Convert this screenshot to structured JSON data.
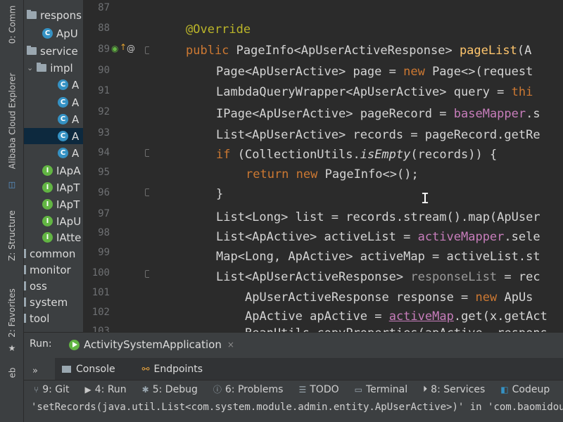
{
  "left_strip": {
    "tabs": [
      {
        "label": "0: Comm",
        "icon": "commit-icon"
      },
      {
        "label": "Alibaba Cloud Explorer",
        "icon": "cloud-explorer-icon"
      },
      {
        "label": "Z: Structure",
        "icon": "structure-icon"
      },
      {
        "label": "2: Favorites",
        "icon": "star-icon"
      },
      {
        "label": "eb"
      }
    ]
  },
  "project_tree": {
    "items": [
      {
        "label": "respons",
        "type": "folder",
        "selected": false
      },
      {
        "label": "ApU",
        "type": "class",
        "selected": false
      },
      {
        "label": "service",
        "type": "folder",
        "selected": false
      },
      {
        "label": "impl",
        "type": "folder",
        "selected": false
      },
      {
        "label": "A",
        "type": "class",
        "selected": false
      },
      {
        "label": "A",
        "type": "class",
        "selected": false
      },
      {
        "label": "A",
        "type": "class",
        "selected": false
      },
      {
        "label": "A",
        "type": "class",
        "selected": true
      },
      {
        "label": "A",
        "type": "class",
        "selected": false
      },
      {
        "label": "IApA",
        "type": "interface",
        "selected": false
      },
      {
        "label": "IApT",
        "type": "interface",
        "selected": false
      },
      {
        "label": "IApT",
        "type": "interface",
        "selected": false
      },
      {
        "label": "IApU",
        "type": "interface",
        "selected": false
      },
      {
        "label": "IAtte",
        "type": "interface",
        "selected": false
      },
      {
        "label": "common",
        "type": "module",
        "selected": false
      },
      {
        "label": "monitor",
        "type": "module",
        "selected": false
      },
      {
        "label": "oss",
        "type": "module",
        "selected": false
      },
      {
        "label": "system",
        "type": "module",
        "selected": false
      },
      {
        "label": "tool",
        "type": "module",
        "selected": false
      }
    ]
  },
  "editor": {
    "line_numbers": [
      "87",
      "88",
      "89",
      "90",
      "91",
      "92",
      "93",
      "94",
      "95",
      "96",
      "97",
      "98",
      "99",
      "100",
      "101",
      "102",
      "103"
    ],
    "lines": {
      "l88": "@Override",
      "l89": {
        "kw": "public",
        "t1": " PageInfo<ApUserActiveResponse> ",
        "fn": "pageList",
        "t2": "(A"
      },
      "l90": {
        "t1": "Page<ApUserActive> page = ",
        "kw": "new",
        "t2": " Page<>(request"
      },
      "l91": {
        "t1": "LambdaQueryWrapper<ApUserActive> query = ",
        "kw": "thi"
      },
      "l92": {
        "t1": "IPage<ApUserActive> pageRecord = ",
        "fld": "baseMapper",
        "t2": ".s"
      },
      "l93": "List<ApUserActive> records = pageRecord.getRe",
      "l94": {
        "kw": "if",
        "t1": " (CollectionUtils.",
        "it": "isEmpty",
        "t2": "(records)) {"
      },
      "l95": {
        "kw1": "return",
        "sp": " ",
        "kw2": "new",
        "t1": " PageInfo<>();"
      },
      "l96": "}",
      "l97": "List<Long> list = records.stream().map(ApUser",
      "l98": {
        "t1": "List<ApActive> activeList = ",
        "fld": "activeMapper",
        "t2": ".sele"
      },
      "l99": "Map<Long, ApActive> activeMap = activeList.st",
      "l100": {
        "t1": "List<ApUserActiveResponse> ",
        "gr": "responseList",
        "t2": " = rec"
      },
      "l101": {
        "t1": "ApUserActiveResponse response = ",
        "kw": "new",
        "t2": " ApUs"
      },
      "l102": {
        "t1": "ApActive apActive = ",
        "ul": "activeMap",
        "t2": ".get(x.getAct"
      },
      "l103": "BeanUtils.copyProperties(apActive, respons"
    }
  },
  "run_panel": {
    "label": "Run:",
    "config_name": "ActivitySystemApplication",
    "close_glyph": "×",
    "subtabs": [
      {
        "label": "Console",
        "icon": "console-icon"
      },
      {
        "label": "Endpoints",
        "icon": "endpoints-icon"
      }
    ],
    "chevrons": "»"
  },
  "tool_windows": [
    {
      "label": "9: Git",
      "icon": "git-icon"
    },
    {
      "label": "4: Run",
      "icon": "run-icon"
    },
    {
      "label": "5: Debug",
      "icon": "debug-icon"
    },
    {
      "label": "6: Problems",
      "icon": "problems-icon"
    },
    {
      "label": "TODO",
      "icon": "todo-icon"
    },
    {
      "label": "Terminal",
      "icon": "terminal-icon"
    },
    {
      "label": "8: Services",
      "icon": "services-icon"
    },
    {
      "label": "Codeup",
      "icon": "codeup-icon"
    }
  ],
  "status_text": "'setRecords(java.util.List<com.system.module.admin.entity.ApUserActive>)' in 'com.baomidou.mybatisplu",
  "colors": {
    "keyword": "#cc7832",
    "annotation": "#bbb529",
    "method": "#ffc66d",
    "field": "#c77dbb",
    "class_icon": "#3592c4",
    "interface_icon": "#62b543",
    "run_icon": "#62b543"
  }
}
